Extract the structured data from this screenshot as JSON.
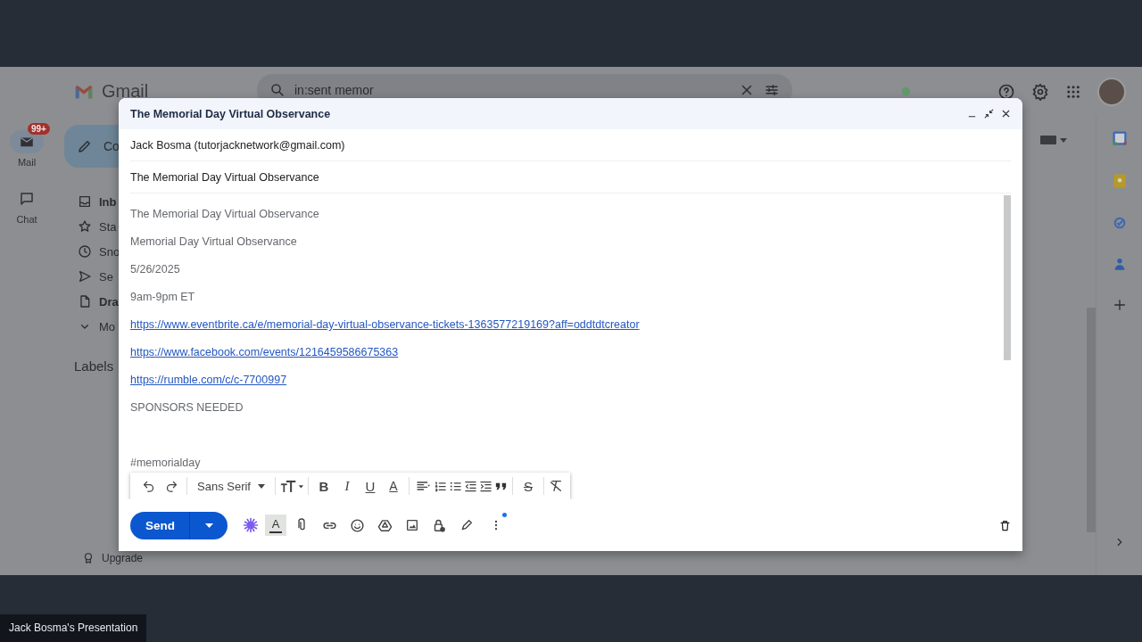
{
  "gmail": {
    "logo": "Gmail",
    "search": {
      "value": "in:sent memor"
    },
    "rail": [
      {
        "label": "Mail",
        "badge": "99+",
        "selected": true
      },
      {
        "label": "Chat",
        "selected": false
      }
    ],
    "compose_button": "Co",
    "nav": [
      {
        "label": "Inb",
        "unread": true
      },
      {
        "label": "Sta",
        "unread": false
      },
      {
        "label": "Sno",
        "unread": false
      },
      {
        "label": "Se",
        "unread": false
      },
      {
        "label": "Dra",
        "unread": true
      },
      {
        "label": "Mo",
        "unread": false
      }
    ],
    "labels_heading": "Labels",
    "upgrade": "Upgrade"
  },
  "compose": {
    "title": "The Memorial Day Virtual Observance",
    "from": "Jack Bosma (tutorjacknetwork@gmail.com)",
    "subject": "The Memorial Day Virtual Observance",
    "body": [
      {
        "kind": "text",
        "text": "The Memorial Day Virtual Observance"
      },
      {
        "kind": "text",
        "text": "Memorial Day Virtual Observance"
      },
      {
        "kind": "text",
        "text": "5/26/2025"
      },
      {
        "kind": "text",
        "text": "9am-9pm ET"
      },
      {
        "kind": "link",
        "text": "https://www.eventbrite.ca/e/memorial-day-virtual-observance-tickets-1363577219169?aff=oddtdtcreator"
      },
      {
        "kind": "link",
        "text": "https://www.facebook.com/events/1216459586675363"
      },
      {
        "kind": "link",
        "text": "https://rumble.com/c/c-7700997"
      },
      {
        "kind": "text",
        "text": "SPONSORS NEEDED"
      },
      {
        "kind": "blank"
      },
      {
        "kind": "text",
        "text": "#memorialday"
      }
    ],
    "format_toolbar": {
      "font": "Sans Serif",
      "glyphs": [
        "B",
        "I",
        "U",
        "A",
        "S"
      ]
    },
    "send": "Send",
    "formatting_toggle": {
      "label": "A",
      "on": true
    }
  },
  "presentation_label": "Jack Bosma's Presentation"
}
